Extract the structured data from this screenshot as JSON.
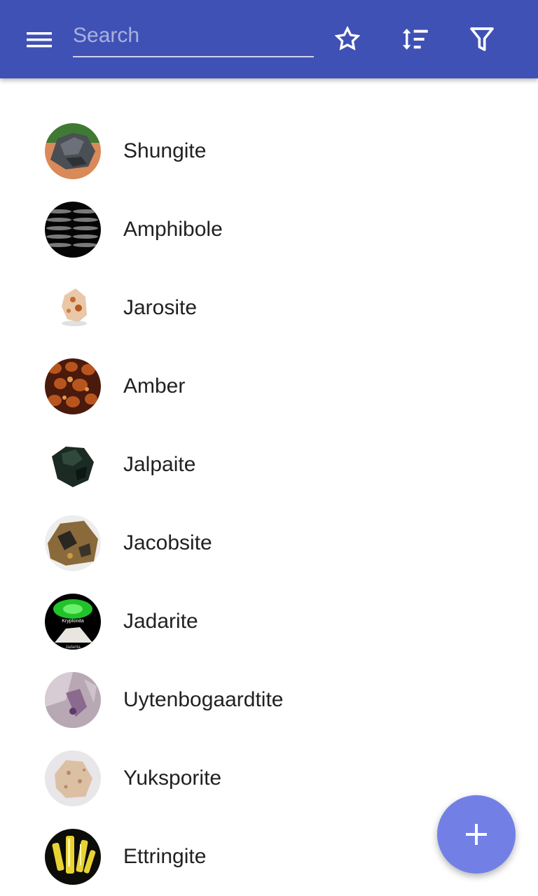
{
  "toolbar": {
    "search_placeholder": "Search",
    "search_value": "",
    "icons": [
      "menu-icon",
      "star-icon",
      "sort-icon",
      "filter-icon"
    ]
  },
  "minerals": [
    {
      "name": "Shungite"
    },
    {
      "name": "Amphibole"
    },
    {
      "name": "Jarosite"
    },
    {
      "name": "Amber"
    },
    {
      "name": "Jalpaite"
    },
    {
      "name": "Jacobsite"
    },
    {
      "name": "Jadarite",
      "image_text": [
        "Kryptonita",
        "Jadarita"
      ]
    },
    {
      "name": "Uytenbogaardtite"
    },
    {
      "name": "Yuksporite"
    },
    {
      "name": "Ettringite"
    }
  ],
  "fab": {
    "icon": "plus-icon"
  },
  "colors": {
    "app_bar": "#3f51b5",
    "fab": "#7280e6",
    "text": "#212121"
  }
}
